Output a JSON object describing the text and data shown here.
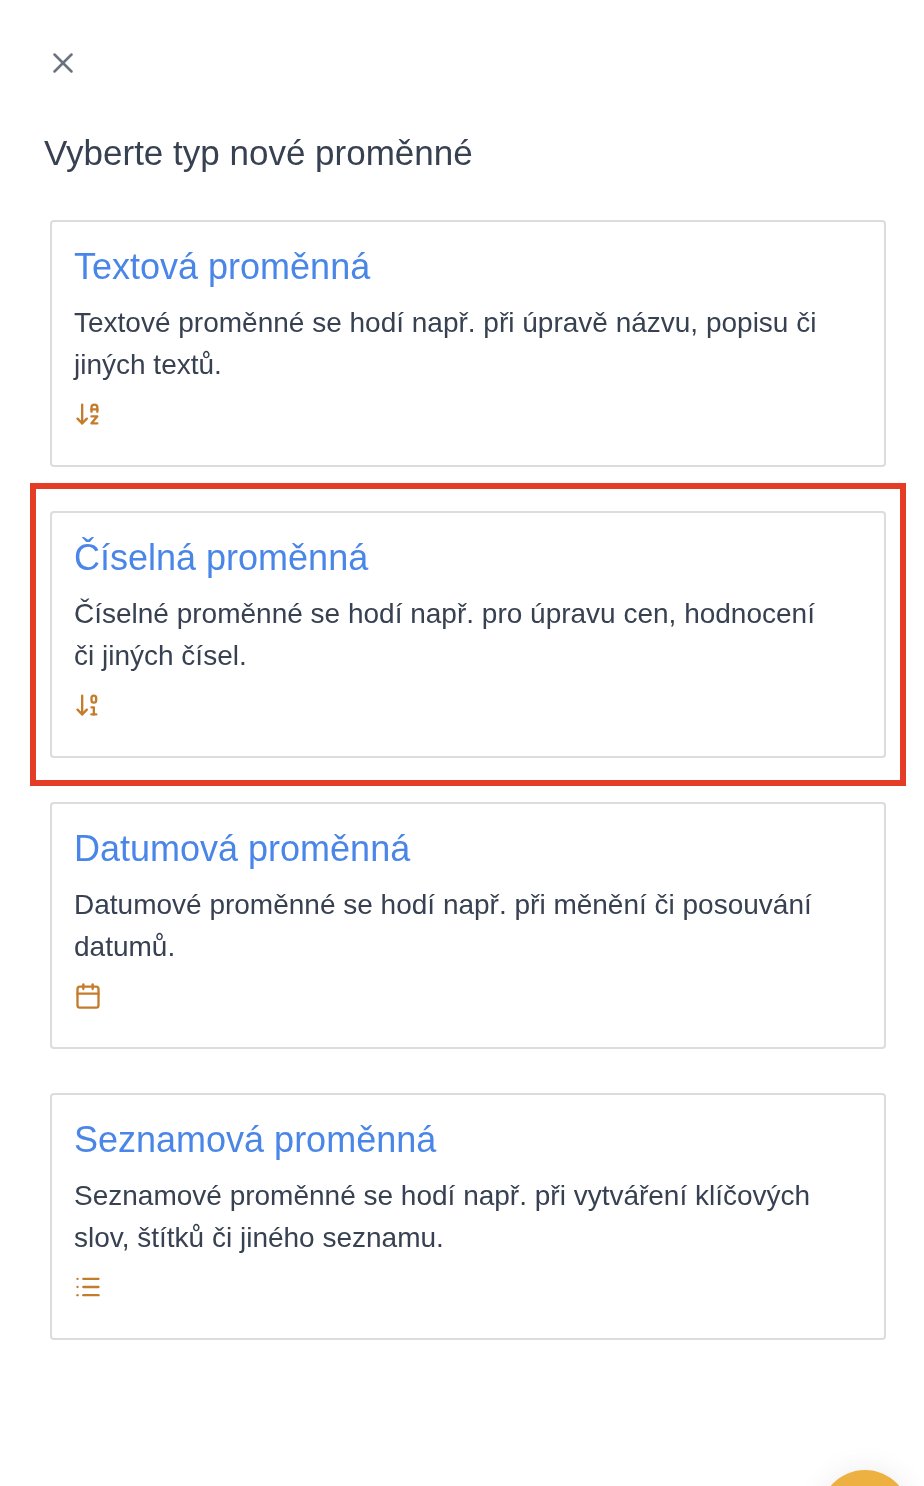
{
  "title": "Vyberte typ nové proměnné",
  "options": [
    {
      "kind": "text",
      "title": "Textová proměnná",
      "description": "Textové proměnné se hodí např. při úpravě názvu, popisu či jiných textů.",
      "selected": false
    },
    {
      "kind": "number",
      "title": "Číselná proměnná",
      "description": "Číselné proměnné se hodí např. pro úpravu cen, hodnocení či jiných čísel.",
      "selected": true
    },
    {
      "kind": "date",
      "title": "Datumová proměnná",
      "description": "Datumové proměnné se hodí např. při měnění či posouvání datumů.",
      "selected": false
    },
    {
      "kind": "list",
      "title": "Seznamová proměnná",
      "description": "Seznamové proměnné se hodí např. při vytváření klíčových slov, štítků či jiného seznamu.",
      "selected": false
    }
  ]
}
